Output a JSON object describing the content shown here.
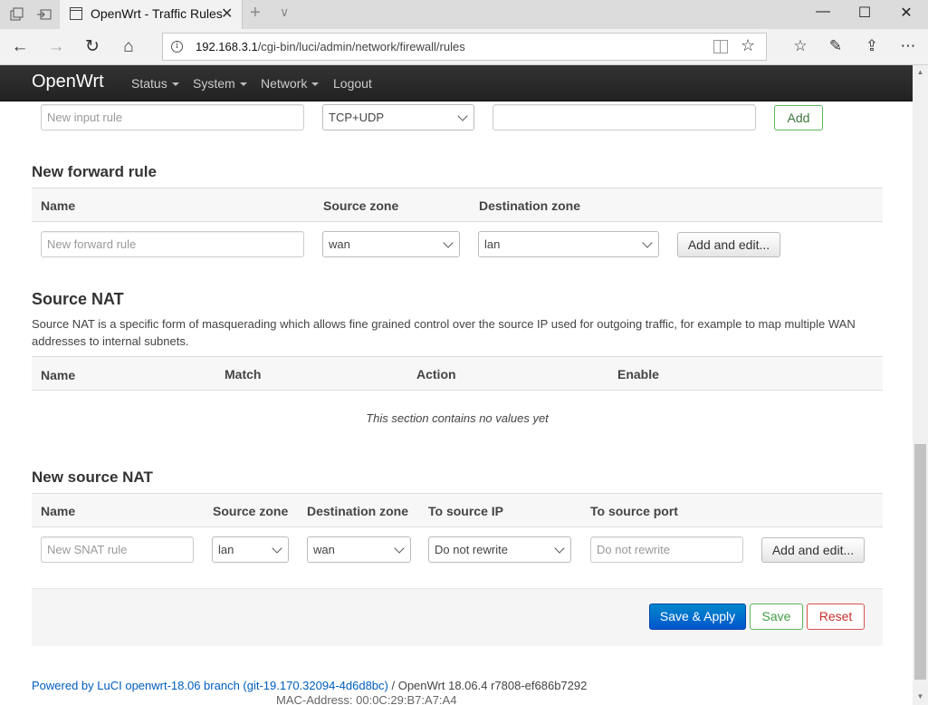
{
  "browser": {
    "tab_title": "OpenWrt - Traffic Rules",
    "url_host": "192.168.3.1",
    "url_path": "/cgi-bin/luci/admin/network/firewall/rules"
  },
  "header": {
    "brand": "OpenWrt",
    "menu": [
      "Status",
      "System",
      "Network",
      "Logout"
    ]
  },
  "input_rule": {
    "name_placeholder": "New input rule",
    "protocol": "TCP+UDP",
    "port_value": "",
    "add_label": "Add"
  },
  "forward_rule": {
    "title": "New forward rule",
    "headers": [
      "Name",
      "Source zone",
      "Destination zone"
    ],
    "name_placeholder": "New forward rule",
    "source_zone": "wan",
    "dest_zone": "lan",
    "add_edit_label": "Add and edit..."
  },
  "source_nat": {
    "title": "Source NAT",
    "description": "Source NAT is a specific form of masquerading which allows fine grained control over the source IP used for outgoing traffic, for example to map multiple WAN addresses to internal subnets.",
    "headers": [
      "Name",
      "Match",
      "Action",
      "Enable"
    ],
    "empty_message": "This section contains no values yet"
  },
  "new_snat": {
    "title": "New source NAT",
    "headers": [
      "Name",
      "Source zone",
      "Destination zone",
      "To source IP",
      "To source port"
    ],
    "name_placeholder": "New SNAT rule",
    "source_zone": "lan",
    "dest_zone": "wan",
    "to_source_ip": "Do not rewrite",
    "to_source_port_placeholder": "Do not rewrite",
    "add_edit_label": "Add and edit..."
  },
  "actions": {
    "save_apply": "Save & Apply",
    "save": "Save",
    "reset": "Reset"
  },
  "footer": {
    "powered_by": "Powered by LuCI openwrt-18.06 branch (git-19.170.32094-4d6d8bc)",
    "version": " / OpenWrt 18.06.4 r7808-ef686b7292",
    "behind_text": "MAC-Address: 00:0C:29:B7:A7:A4"
  }
}
